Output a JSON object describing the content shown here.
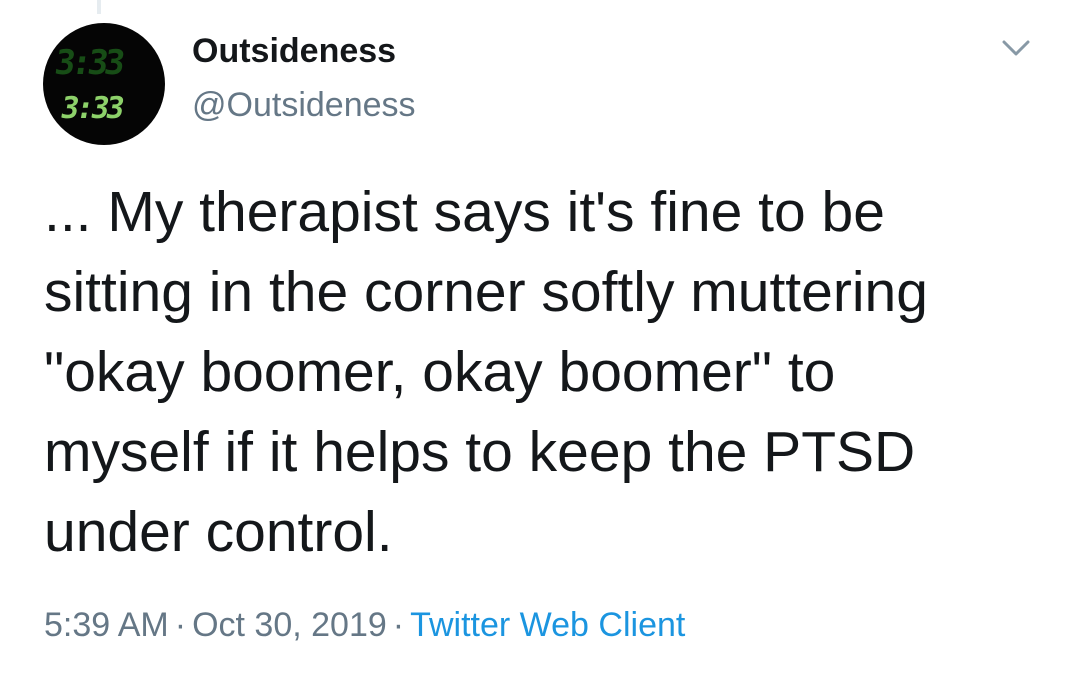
{
  "user": {
    "display_name": "Outsideness",
    "handle": "@Outsideness",
    "avatar_clock_text": "3:33",
    "avatar_ghost_text": "3:33"
  },
  "tweet": {
    "text": "... My therapist says it's fine to be\nsitting in the corner softly muttering\n\"okay boomer, okay boomer\" to\nmyself if it helps to keep the PTSD\nunder control."
  },
  "meta": {
    "time": "5:39 AM",
    "separator": "·",
    "date": "Oct 30, 2019",
    "source": "Twitter Web Client"
  },
  "icons": {
    "caret": "chevron-down-icon"
  },
  "colors": {
    "text_primary": "#14171a",
    "text_secondary": "#657786",
    "link": "#1b95e0",
    "avatar_digits": "#8dd16a"
  }
}
